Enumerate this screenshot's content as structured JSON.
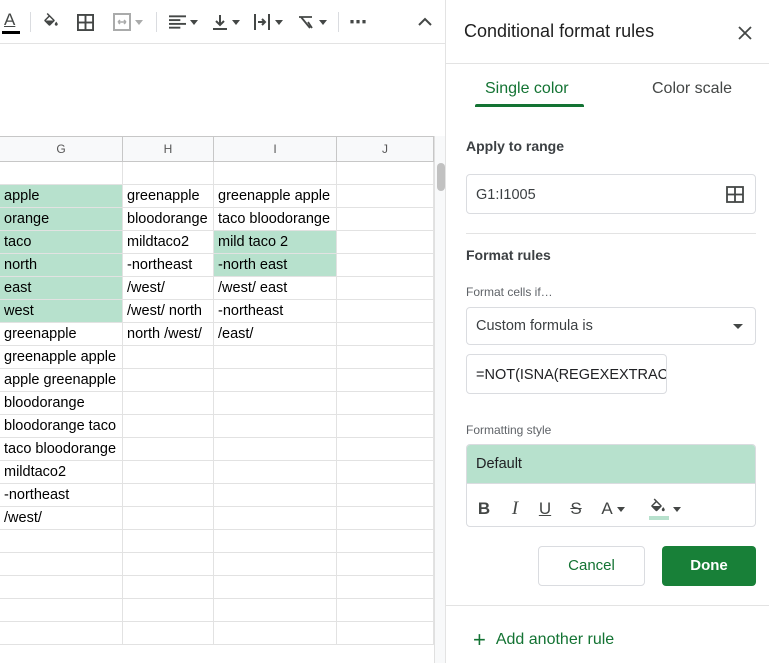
{
  "toolbar": {
    "icons": [
      "text-color-icon",
      "fill-color-icon",
      "borders-icon",
      "merge-cells-icon",
      "horizontal-align-icon",
      "vertical-align-icon",
      "text-wrapping-icon",
      "text-rotation-icon",
      "more-icon",
      "collapse-toolbar-icon"
    ],
    "text_color_letter": "A",
    "more_label": "⋯"
  },
  "sheet": {
    "columns": [
      "G",
      "H",
      "I",
      "J"
    ],
    "rows": [
      [
        "apple",
        "greenapple",
        "greenapple apple",
        ""
      ],
      [
        "orange",
        "bloodorange",
        "taco bloodorange",
        ""
      ],
      [
        "taco",
        "mildtaco2",
        "mild taco 2",
        ""
      ],
      [
        "north",
        "-northeast",
        "-north east",
        ""
      ],
      [
        "east",
        "/west/",
        "/west/ east",
        ""
      ],
      [
        "west",
        "/west/ north",
        "-northeast",
        ""
      ],
      [
        "greenapple",
        "north /west/",
        "/east/",
        ""
      ],
      [
        "greenapple apple",
        "",
        "",
        ""
      ],
      [
        "apple greenapple",
        "",
        "",
        ""
      ],
      [
        "bloodorange",
        "",
        "",
        ""
      ],
      [
        "bloodorange taco",
        "",
        "",
        ""
      ],
      [
        "taco bloodorange",
        "",
        "",
        ""
      ],
      [
        "mildtaco2",
        "",
        "",
        ""
      ],
      [
        "-northeast",
        "",
        "",
        ""
      ],
      [
        "/west/",
        "",
        "",
        ""
      ],
      [
        "",
        "",
        "",
        ""
      ],
      [
        "",
        "",
        "",
        ""
      ],
      [
        "",
        "",
        "",
        ""
      ],
      [
        "",
        "",
        "",
        ""
      ],
      [
        "",
        "",
        "",
        ""
      ]
    ],
    "highlighted_cells": [
      [
        0,
        0
      ],
      [
        1,
        0
      ],
      [
        2,
        0
      ],
      [
        3,
        0
      ],
      [
        4,
        0
      ],
      [
        5,
        0
      ],
      [
        2,
        2
      ],
      [
        3,
        2
      ]
    ],
    "highlight_color": "#b7e1cd"
  },
  "panel": {
    "title": "Conditional format rules",
    "tabs": [
      {
        "label": "Single color",
        "active": true
      },
      {
        "label": "Color scale",
        "active": false
      }
    ],
    "apply_to_range_label": "Apply to range",
    "range_value": "G1:I1005",
    "format_rules_label": "Format rules",
    "format_cells_if_label": "Format cells if…",
    "condition_value": "Custom formula is",
    "formula_value": "=NOT(ISNA(REGEXEXTRACT(",
    "formatting_style_label": "Formatting style",
    "style_preview_text": "Default",
    "style_preview_color": "#b7e1cd",
    "format_buttons": {
      "bold": "B",
      "italic": "I",
      "underline": "U",
      "strikethrough": "S",
      "text_color": "A"
    },
    "cancel_label": "Cancel",
    "done_label": "Done",
    "add_rule_label": "Add another rule",
    "add_rule_symbol": "+",
    "accent_color": "#137333"
  }
}
